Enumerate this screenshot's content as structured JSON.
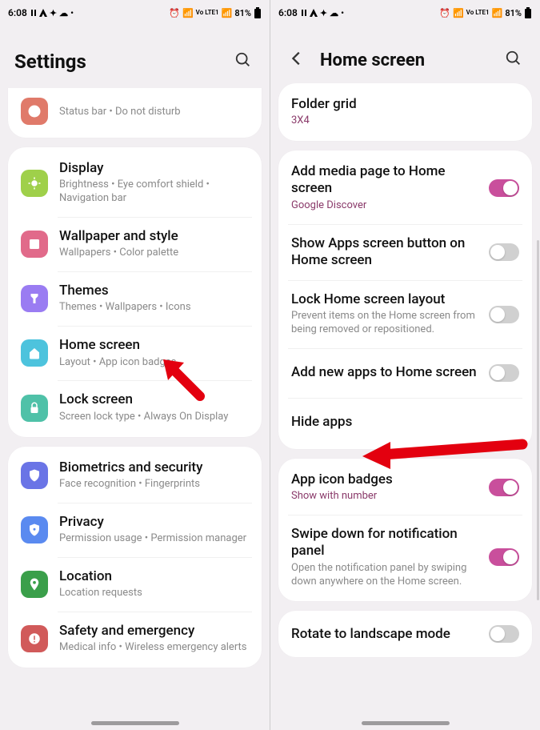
{
  "status": {
    "time": "6:08",
    "battery": "81%",
    "network": "Vo LTE1"
  },
  "left": {
    "title": "Settings",
    "notif_sub": "Status bar  •  Do not disturb",
    "groups": [
      {
        "items": [
          {
            "name": "display",
            "title": "Display",
            "sub": "Brightness  •  Eye comfort shield  •  Navigation bar"
          },
          {
            "name": "wallpaper",
            "title": "Wallpaper and style",
            "sub": "Wallpapers  •  Color palette"
          },
          {
            "name": "themes",
            "title": "Themes",
            "sub": "Themes  •  Wallpapers  •  Icons"
          },
          {
            "name": "home-screen",
            "title": "Home screen",
            "sub": "Layout  •  App icon badges"
          },
          {
            "name": "lock-screen",
            "title": "Lock screen",
            "sub": "Screen lock type  •  Always On Display"
          }
        ]
      },
      {
        "items": [
          {
            "name": "biometrics",
            "title": "Biometrics and security",
            "sub": "Face recognition  •  Fingerprints"
          },
          {
            "name": "privacy",
            "title": "Privacy",
            "sub": "Permission usage  •  Permission manager"
          },
          {
            "name": "location",
            "title": "Location",
            "sub": "Location requests"
          },
          {
            "name": "safety",
            "title": "Safety and emergency",
            "sub": "Medical info  •  Wireless emergency alerts"
          }
        ]
      }
    ]
  },
  "right": {
    "title": "Home screen",
    "folder_grid_label": "Folder grid",
    "folder_grid_value": "3X4",
    "items": [
      {
        "name": "add-media",
        "title": "Add media page to Home screen",
        "sub": "Google Discover",
        "accent": true,
        "toggle": true,
        "on": true
      },
      {
        "name": "show-apps-btn",
        "title": "Show Apps screen button on Home screen",
        "toggle": true,
        "on": false
      },
      {
        "name": "lock-layout",
        "title": "Lock Home screen layout",
        "sub": "Prevent items on the Home screen from being removed or repositioned.",
        "toggle": true,
        "on": false
      },
      {
        "name": "add-new-apps",
        "title": "Add new apps to Home screen",
        "toggle": true,
        "on": false
      },
      {
        "name": "hide-apps",
        "title": "Hide apps"
      }
    ],
    "items2": [
      {
        "name": "app-icon-badges",
        "title": "App icon badges",
        "sub": "Show with number",
        "accent": true,
        "toggle": true,
        "on": true
      },
      {
        "name": "swipe-down",
        "title": "Swipe down for notification panel",
        "sub": "Open the notification panel by swiping down anywhere on the Home screen.",
        "toggle": true,
        "on": true
      }
    ],
    "rotate_label": "Rotate to landscape mode"
  }
}
